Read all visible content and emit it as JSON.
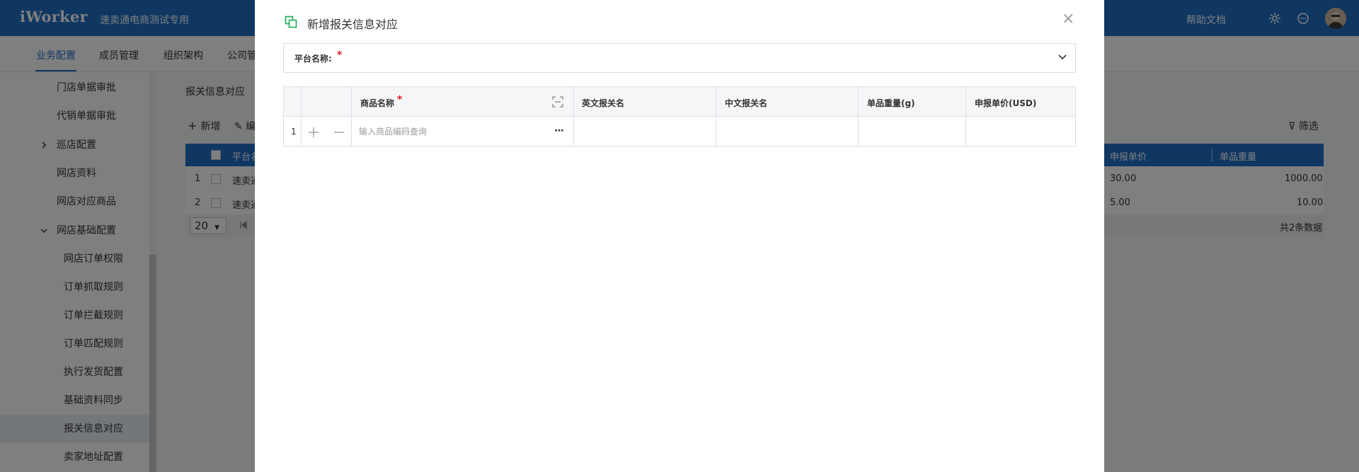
{
  "header": {
    "logo": "iWorker",
    "company": "速卖通电商测试专用",
    "help": "帮助文档",
    "icons": [
      "gear-icon",
      "chat-icon",
      "avatar"
    ]
  },
  "nav": {
    "tabs": [
      "业务配置",
      "成员管理",
      "组织架构",
      "公司管"
    ],
    "active_index": 0
  },
  "sidebar": {
    "items": [
      {
        "label": "门店单据审批",
        "level": 1
      },
      {
        "label": "代销单据审批",
        "level": 1
      },
      {
        "label": "巡店配置",
        "level": 1,
        "arrow": "right"
      },
      {
        "label": "网店资料",
        "level": 1
      },
      {
        "label": "网店对应商品",
        "level": 1
      },
      {
        "label": "网店基础配置",
        "level": 1,
        "arrow": "down"
      },
      {
        "label": "网店订单权限",
        "level": 2
      },
      {
        "label": "订单抓取规则",
        "level": 2
      },
      {
        "label": "订单拦截规则",
        "level": 2
      },
      {
        "label": "订单匹配规则",
        "level": 2
      },
      {
        "label": "执行发货配置",
        "level": 2
      },
      {
        "label": "基础资料同步",
        "level": 2
      },
      {
        "label": "报关信息对应",
        "level": 2,
        "active": true
      },
      {
        "label": "卖家地址配置",
        "level": 2
      }
    ]
  },
  "main": {
    "breadcrumb": "报关信息对应",
    "toolbar": {
      "add": "新增",
      "edit": "编",
      "filter": "筛选"
    },
    "grid_columns": [
      "平台名",
      "申报单价",
      "单品重量"
    ],
    "rows": [
      {
        "num": "1",
        "platform": "速卖通",
        "price": "30.00",
        "weight": "1000.00"
      },
      {
        "num": "2",
        "platform": "速卖通",
        "price": "5.00",
        "weight": "10.00"
      }
    ],
    "pager": {
      "page_size": "20",
      "total": "共2条数据"
    }
  },
  "modal": {
    "title": "新增报关信息对应",
    "close": "×",
    "platform_label": "平台名称:",
    "required_mark": "*",
    "table": {
      "headers": [
        "商品名称",
        "英文报关名",
        "中文报关名",
        "单品重量(g)",
        "申报单价(USD)"
      ],
      "row_num": "1",
      "input_placeholder": "输入商品编码查询",
      "more": "···"
    }
  },
  "colors": {
    "primary": "#1e6fc5",
    "required": "#e02020",
    "overlay": "rgba(0,0,0,0.5)",
    "modal_icon": "#1aaa55"
  }
}
